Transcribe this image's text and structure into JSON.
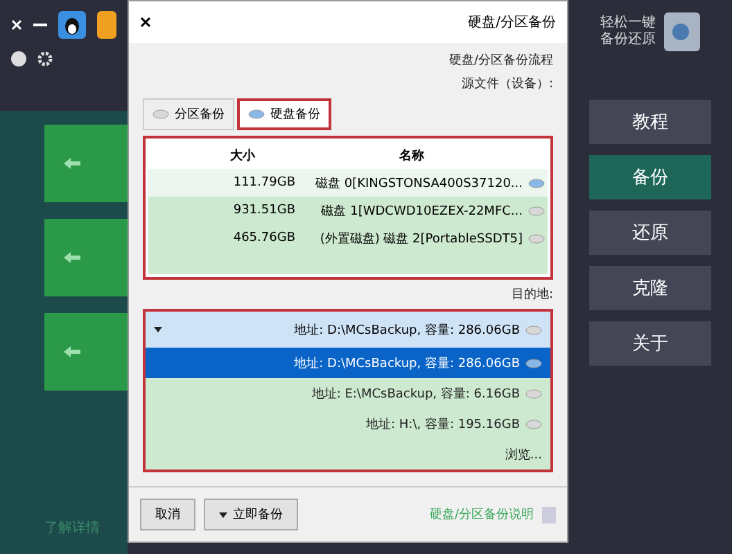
{
  "app": {
    "logo_lines": [
      "轻松一键",
      "备份还原"
    ],
    "nav": [
      {
        "label": "教程",
        "selected": false
      },
      {
        "label": "备份",
        "selected": true
      },
      {
        "label": "还原",
        "selected": false
      },
      {
        "label": "克隆",
        "selected": false
      },
      {
        "label": "关于",
        "selected": false
      }
    ],
    "side_link": "了解详情"
  },
  "dialog": {
    "title": "硬盘/分区备份",
    "heading": "硬盘/分区备份流程",
    "source_label": "源文件（设备）:",
    "tabs": [
      {
        "label": "分区备份",
        "selected": false
      },
      {
        "label": "硬盘备份",
        "selected": true
      }
    ],
    "columns": [
      "大小",
      "名称"
    ],
    "rows": [
      {
        "name": "磁盘 0[KINGSTONSA400S37120...",
        "size": "111.79GB",
        "selected": true
      },
      {
        "name": "磁盘 1[WDCWD10EZEX-22MFC...",
        "size": "931.51GB",
        "selected": false
      },
      {
        "name": "(外置磁盘) 磁盘 2[PortableSSDT5]",
        "size": "465.76GB",
        "selected": false
      }
    ],
    "target_label": "目的地:",
    "target_value": "地址: D:\\MCsBackup, 容量: 286.06GB",
    "options": [
      {
        "label": "地址: D:\\MCsBackup, 容量: 286.06GB",
        "selected": true
      },
      {
        "label": "地址: E:\\MCsBackup, 容量: 6.16GB",
        "selected": false
      },
      {
        "label": "地址: H:\\, 容量: 195.16GB",
        "selected": false
      }
    ],
    "browse": "浏览...",
    "help_link": "硬盘/分区备份说明",
    "buttons": [
      "取消",
      "立即备份"
    ]
  }
}
